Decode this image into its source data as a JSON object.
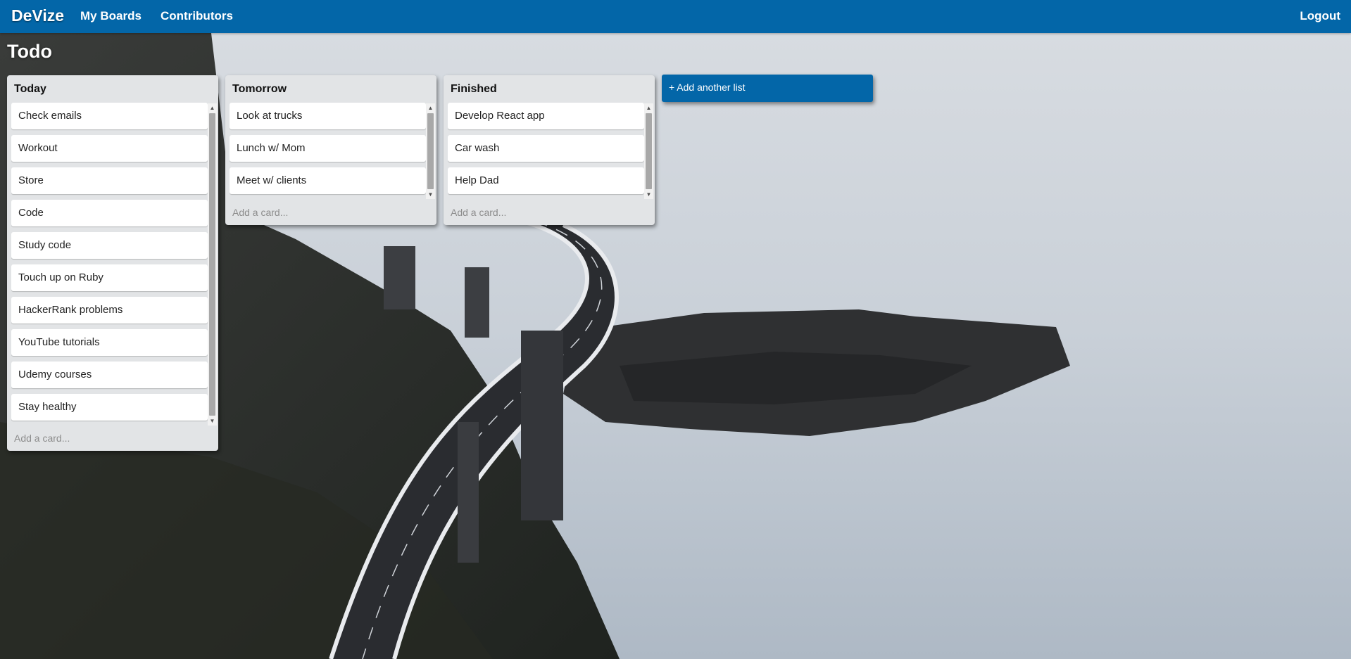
{
  "nav": {
    "brand": "DeVize",
    "links": [
      "My Boards",
      "Contributors"
    ],
    "logout": "Logout"
  },
  "board": {
    "title": "Todo"
  },
  "lists": [
    {
      "title": "Today",
      "cards": [
        "Check emails",
        "Workout",
        "Store",
        "Code",
        "Study code",
        "Touch up on Ruby",
        "HackerRank problems",
        "YouTube tutorials",
        "Udemy courses",
        "Stay healthy"
      ],
      "add_card": "Add a card..."
    },
    {
      "title": "Tomorrow",
      "cards": [
        "Look at trucks",
        "Lunch w/ Mom",
        "Meet w/ clients"
      ],
      "add_card": "Add a card..."
    },
    {
      "title": "Finished",
      "cards": [
        "Develop React app",
        "Car wash",
        "Help Dad"
      ],
      "add_card": "Add a card..."
    }
  ],
  "add_list": "+ Add another list",
  "colors": {
    "nav_bg": "#0366a8",
    "list_bg": "#e2e4e6",
    "card_bg": "#ffffff",
    "add_card_text": "#8c8c8c"
  },
  "icons": {
    "scroll_up": "▲",
    "scroll_down": "▼"
  }
}
